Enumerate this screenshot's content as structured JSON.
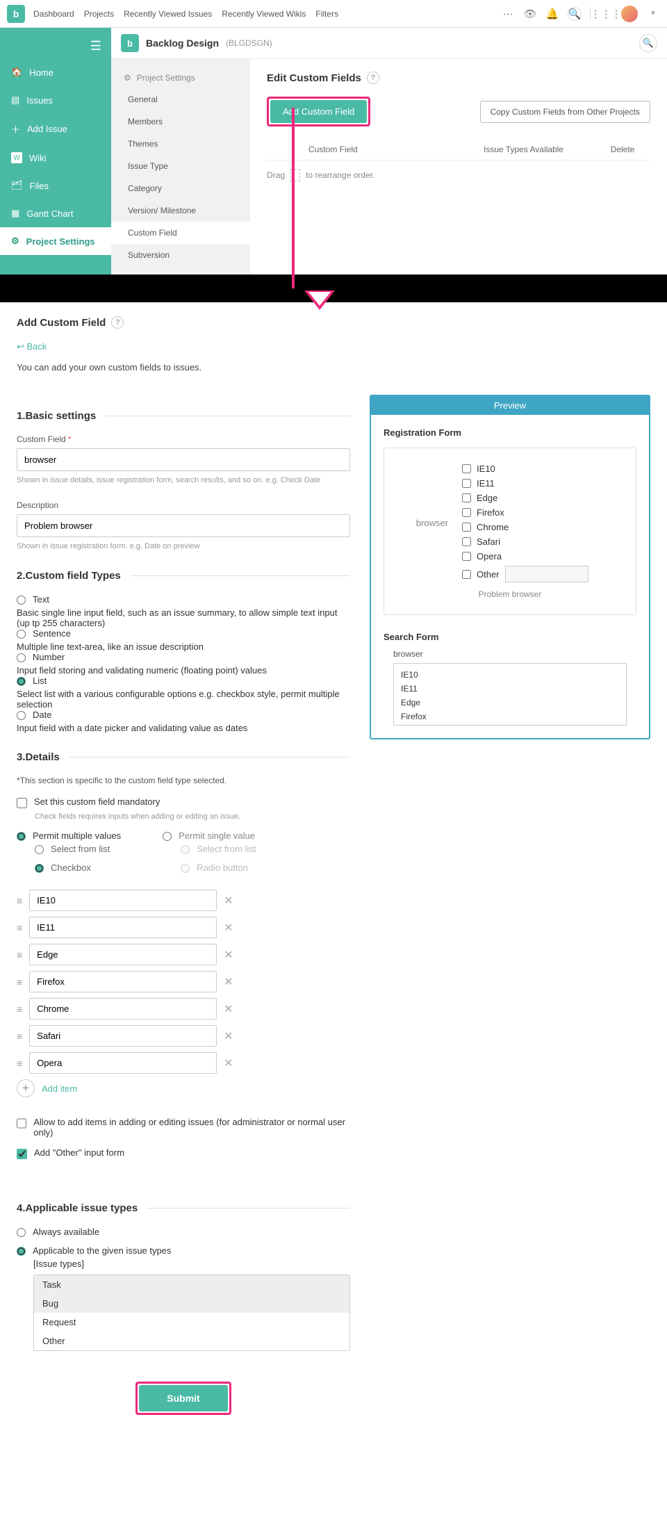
{
  "topnav": [
    "Dashboard",
    "Projects",
    "Recently Viewed Issues",
    "Recently Viewed Wikis",
    "Filters"
  ],
  "project": {
    "name": "Backlog Design",
    "key": "(BLGDSGN)"
  },
  "sidebar": [
    {
      "icon": "🏠",
      "label": "Home"
    },
    {
      "icon": "▤",
      "label": "Issues"
    },
    {
      "icon": "＋",
      "label": "Add Issue"
    },
    {
      "icon": "W",
      "label": "Wiki"
    },
    {
      "icon": "🗂",
      "label": "Files"
    },
    {
      "icon": "▦",
      "label": "Gantt Chart"
    },
    {
      "icon": "⚙",
      "label": "Project Settings",
      "active": true
    }
  ],
  "settingsMenu": {
    "header": "Project Settings",
    "items": [
      "General",
      "Members",
      "Themes",
      "Issue Type",
      "Category",
      "Version/ Milestone",
      "Custom Field",
      "Subversion"
    ],
    "active": "Custom Field"
  },
  "ecf": {
    "title": "Edit Custom Fields",
    "addBtn": "Add Custom Field",
    "copyBtn": "Copy Custom Fields from Other Projects",
    "cols": [
      "",
      "Custom Field",
      "Issue Types Available",
      "Delete"
    ],
    "dragMsg": [
      "Drag",
      "to rearrange order."
    ]
  },
  "cf": {
    "title": "Add Custom Field",
    "back": "Back",
    "intro": "You can add your own custom fields to issues.",
    "s1": "1.Basic settings",
    "name": {
      "label": "Custom Field",
      "value": "browser",
      "help": "Shown in issue details, issue registration form, search results, and so on. e.g. Check Date"
    },
    "desc": {
      "label": "Description",
      "value": "Problem browser",
      "help": "Shown in issue registration form. e.g. Date on preview"
    },
    "s2": "2.Custom field Types",
    "types": [
      {
        "t": "Text",
        "d": "Basic single line input field, such as an issue summary, to allow simple text input (up tp 255 characters)"
      },
      {
        "t": "Sentence",
        "d": "Multiple line text-area, like an issue description"
      },
      {
        "t": "Number",
        "d": "Input field storing and validating numeric (floating point) values"
      },
      {
        "t": "List",
        "d": "Select list with a various configurable options e.g. checkbox style, permit multiple selection",
        "sel": true
      },
      {
        "t": "Date",
        "d": "Input field with a date picker and validating value as dates"
      }
    ],
    "s3": "3.Details",
    "s3note": "*This section is specific to the custom field type selected.",
    "mandatory": {
      "label": "Set this custom field mandatory",
      "help": "Check fields requires inputs when adding or editing an issue."
    },
    "multi": {
      "a": "Permit multiple values",
      "b": "Permit single value",
      "a1": "Select from list",
      "a2": "Checkbox",
      "b1": "Select from list",
      "b2": "Radio button"
    },
    "items": [
      "IE10",
      "IE11",
      "Edge",
      "Firefox",
      "Chrome",
      "Safari",
      "Opera"
    ],
    "addItem": "Add item",
    "allow": "Allow to add items in adding or editing issues (for administrator or normal user only)",
    "other": "Add \"Other\" input form",
    "s4": "4.Applicable issue types",
    "avail": {
      "a": "Always available",
      "b": "Applicable to the given issue types",
      "bl": "[Issue types]"
    },
    "issueTypes": [
      "Task",
      "Bug",
      "Request",
      "Other"
    ],
    "submit": "Submit"
  },
  "preview": {
    "hd": "Preview",
    "regTitle": "Registration Form",
    "fieldName": "browser",
    "opts": [
      "IE10",
      "IE11",
      "Edge",
      "Firefox",
      "Chrome",
      "Safari",
      "Opera"
    ],
    "otherLabel": "Other",
    "helpText": "Problem browser",
    "sfTitle": "Search Form",
    "sfLabel": "browser",
    "sfOpts": [
      "IE10",
      "IE11",
      "Edge",
      "Firefox"
    ]
  }
}
